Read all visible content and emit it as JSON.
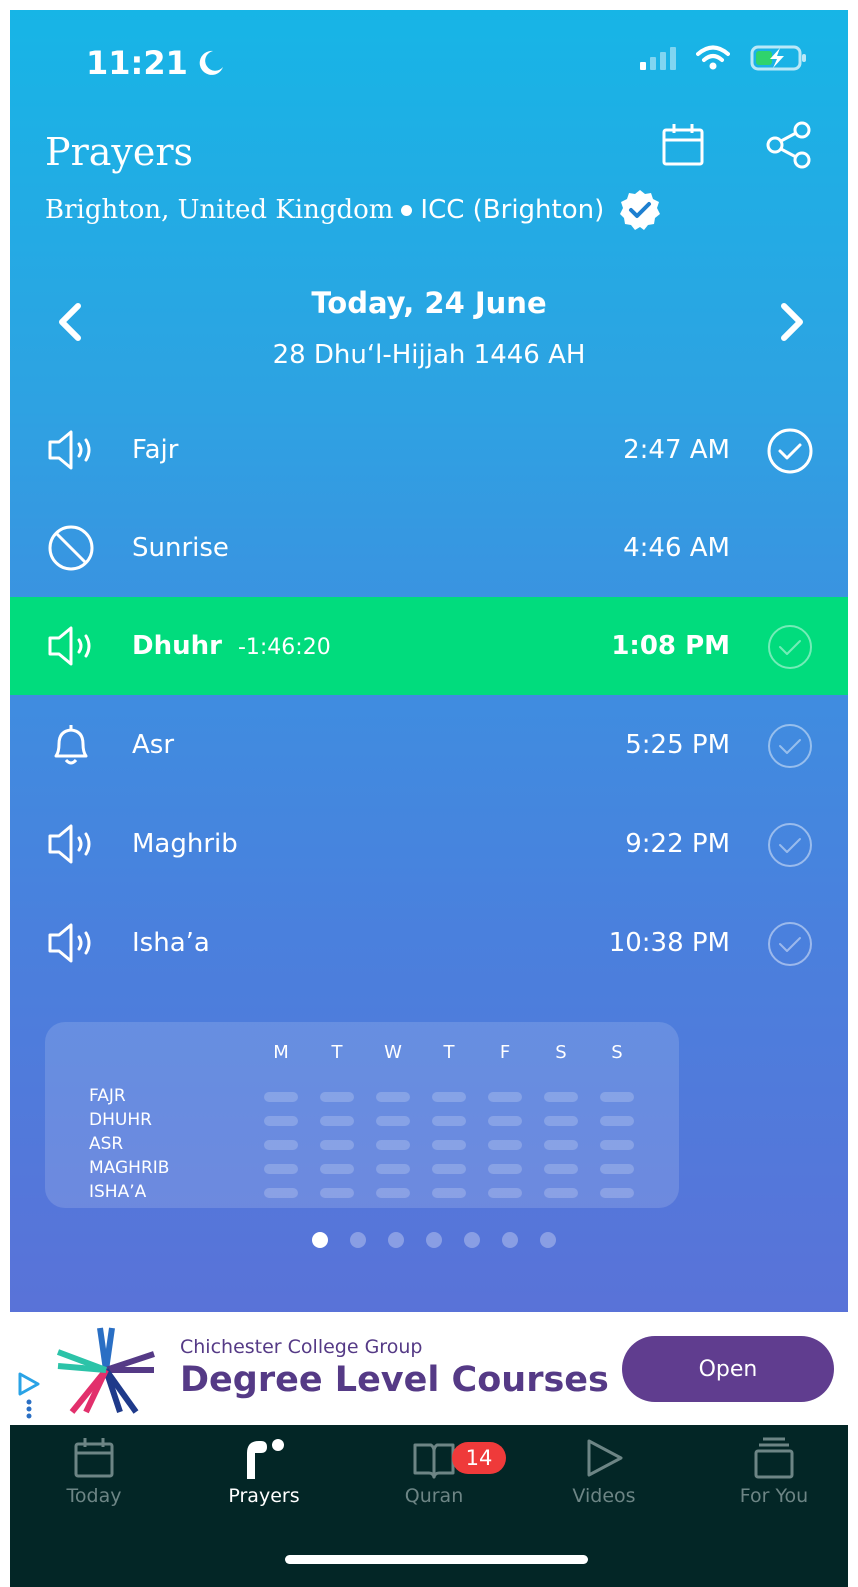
{
  "status_bar": {
    "time": "11:21"
  },
  "header": {
    "title": "Prayers",
    "city": "Brighton, United Kingdom",
    "mosque": "ICC (Brighton)"
  },
  "date": {
    "main": "Today, 24 June",
    "hijri": "28 Dhu‘l-Hijjah 1446 AH"
  },
  "prayers": [
    {
      "name": "Fajr",
      "time": "2:47 AM",
      "icon": "speaker-icon",
      "checked": true
    },
    {
      "name": "Sunrise",
      "time": "4:46 AM",
      "icon": "no-sound-icon",
      "checked": null
    },
    {
      "name": "Dhuhr",
      "countdown": "-1:46:20",
      "time": "1:08 PM",
      "icon": "speaker-icon",
      "checked": false,
      "active": true
    },
    {
      "name": "Asr",
      "time": "5:25 PM",
      "icon": "bell-icon",
      "checked": false
    },
    {
      "name": "Maghrib",
      "time": "9:22 PM",
      "icon": "speaker-icon",
      "checked": false
    },
    {
      "name": "Isha’a",
      "time": "10:38 PM",
      "icon": "speaker-icon",
      "checked": false
    }
  ],
  "tracker": {
    "days": [
      "M",
      "T",
      "W",
      "T",
      "F",
      "S",
      "S"
    ],
    "prayers": [
      "FAJR",
      "DHUHR",
      "ASR",
      "MAGHRIB",
      "ISHA’A"
    ]
  },
  "pager": {
    "count": 7,
    "active": 0
  },
  "ad": {
    "company": "Chichester College Group",
    "headline": "Degree Level Courses",
    "button": "Open"
  },
  "tabs": [
    {
      "label": "Today",
      "icon": "calendar-icon"
    },
    {
      "label": "Prayers",
      "icon": "prayers-logo-icon",
      "active": true
    },
    {
      "label": "Quran",
      "icon": "book-icon",
      "badge": "14"
    },
    {
      "label": "Videos",
      "icon": "play-icon"
    },
    {
      "label": "For You",
      "icon": "stack-icon"
    }
  ],
  "colors": {
    "gradient_top": "#17b5e6",
    "gradient_bottom": "#5a72d8",
    "active_row": "#01dc7d",
    "ad_purple": "#603d8f",
    "tabbar": "#032626",
    "badge": "#ef3a3a"
  }
}
